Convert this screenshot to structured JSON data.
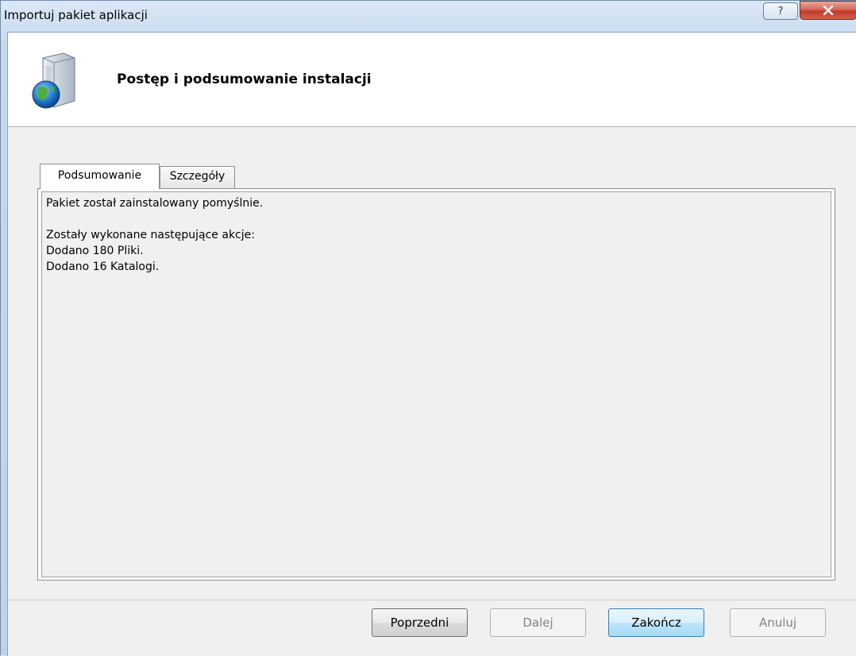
{
  "window": {
    "title": "Importuj pakiet aplikacji",
    "help_glyph": "?",
    "close_glyph": "✕"
  },
  "header": {
    "icon": "package-globe-icon",
    "title": "Postęp i podsumowanie instalacji"
  },
  "tabs": [
    {
      "label": "Podsumowanie",
      "active": true
    },
    {
      "label": "Szczegóły",
      "active": false
    }
  ],
  "summary": {
    "lines": [
      "Pakiet został zainstalowany pomyślnie.",
      "",
      "Zostały wykonane następujące akcje:",
      "Dodano 180 Pliki.",
      "Dodano 16 Katalogi."
    ]
  },
  "buttons": {
    "previous": "Poprzedni",
    "next": "Dalej",
    "finish": "Zakończ",
    "cancel": "Anuluj"
  },
  "colors": {
    "accent": "#3c7fb1",
    "close": "#c2392a"
  }
}
